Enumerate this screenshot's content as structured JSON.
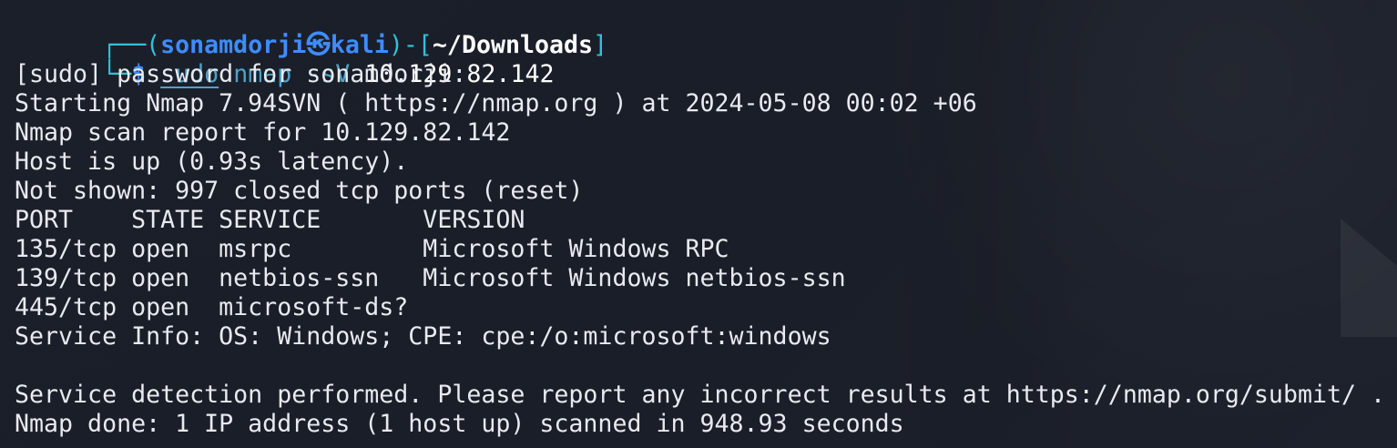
{
  "prompt": {
    "corner_top": "┌──(",
    "user": "sonamdorji",
    "at_symbol": "㉿",
    "host": "kali",
    "separator": ")-[",
    "path": "~/Downloads",
    "path_end": "]",
    "corner_bottom": "└─",
    "dollar": "$",
    "sudo": "sudo",
    "command": "nmap",
    "flag": "-sV",
    "target": "10.129.82.142"
  },
  "output": {
    "password": "[sudo] password for sonamdorji:",
    "starting": "Starting Nmap 7.94SVN ( https://nmap.org ) at 2024-05-08 00:02 +06",
    "report": "Nmap scan report for 10.129.82.142",
    "host_up": "Host is up (0.93s latency).",
    "not_shown": "Not shown: 997 closed tcp ports (reset)",
    "table_header": "PORT    STATE SERVICE       VERSION",
    "rows": [
      "135/tcp open  msrpc         Microsoft Windows RPC",
      "139/tcp open  netbios-ssn   Microsoft Windows netbios-ssn",
      "445/tcp open  microsoft-ds?"
    ],
    "service_info": "Service Info: OS: Windows; CPE: cpe:/o:microsoft:windows",
    "blank": "",
    "service_detection": "Service detection performed. Please report any incorrect results at https://nmap.org/submit/ .",
    "done": "Nmap done: 1 IP address (1 host up) scanned in 948.93 seconds"
  },
  "colors": {
    "background": "#1b1f2a",
    "text": "#e7eaf0",
    "prompt_frame": "#31c1d8",
    "user_host": "#3d8cff",
    "command": "#4fa2c9"
  }
}
